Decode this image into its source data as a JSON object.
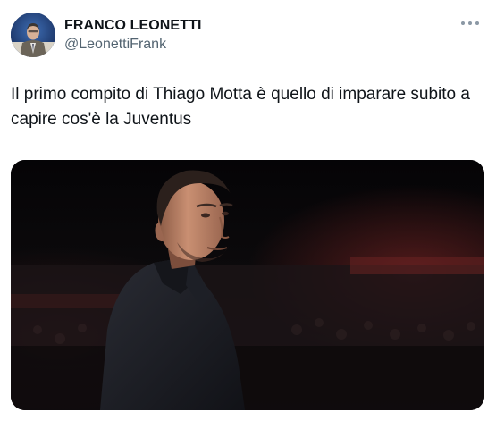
{
  "tweet": {
    "author": {
      "display_name": "FRANCO LEONETTI",
      "handle": "@LeonettiFrank",
      "avatar_icon": "profile-photo"
    },
    "more_icon": "more-horizontal-icon",
    "text": "Il primo compito di Thiago Motta è quello di imparare subito a capire cos'è la Juventus",
    "media": {
      "type": "photo"
    }
  },
  "colors": {
    "text_primary": "#0f1419",
    "text_secondary": "#536471",
    "media_background": "#0b0a0c"
  }
}
